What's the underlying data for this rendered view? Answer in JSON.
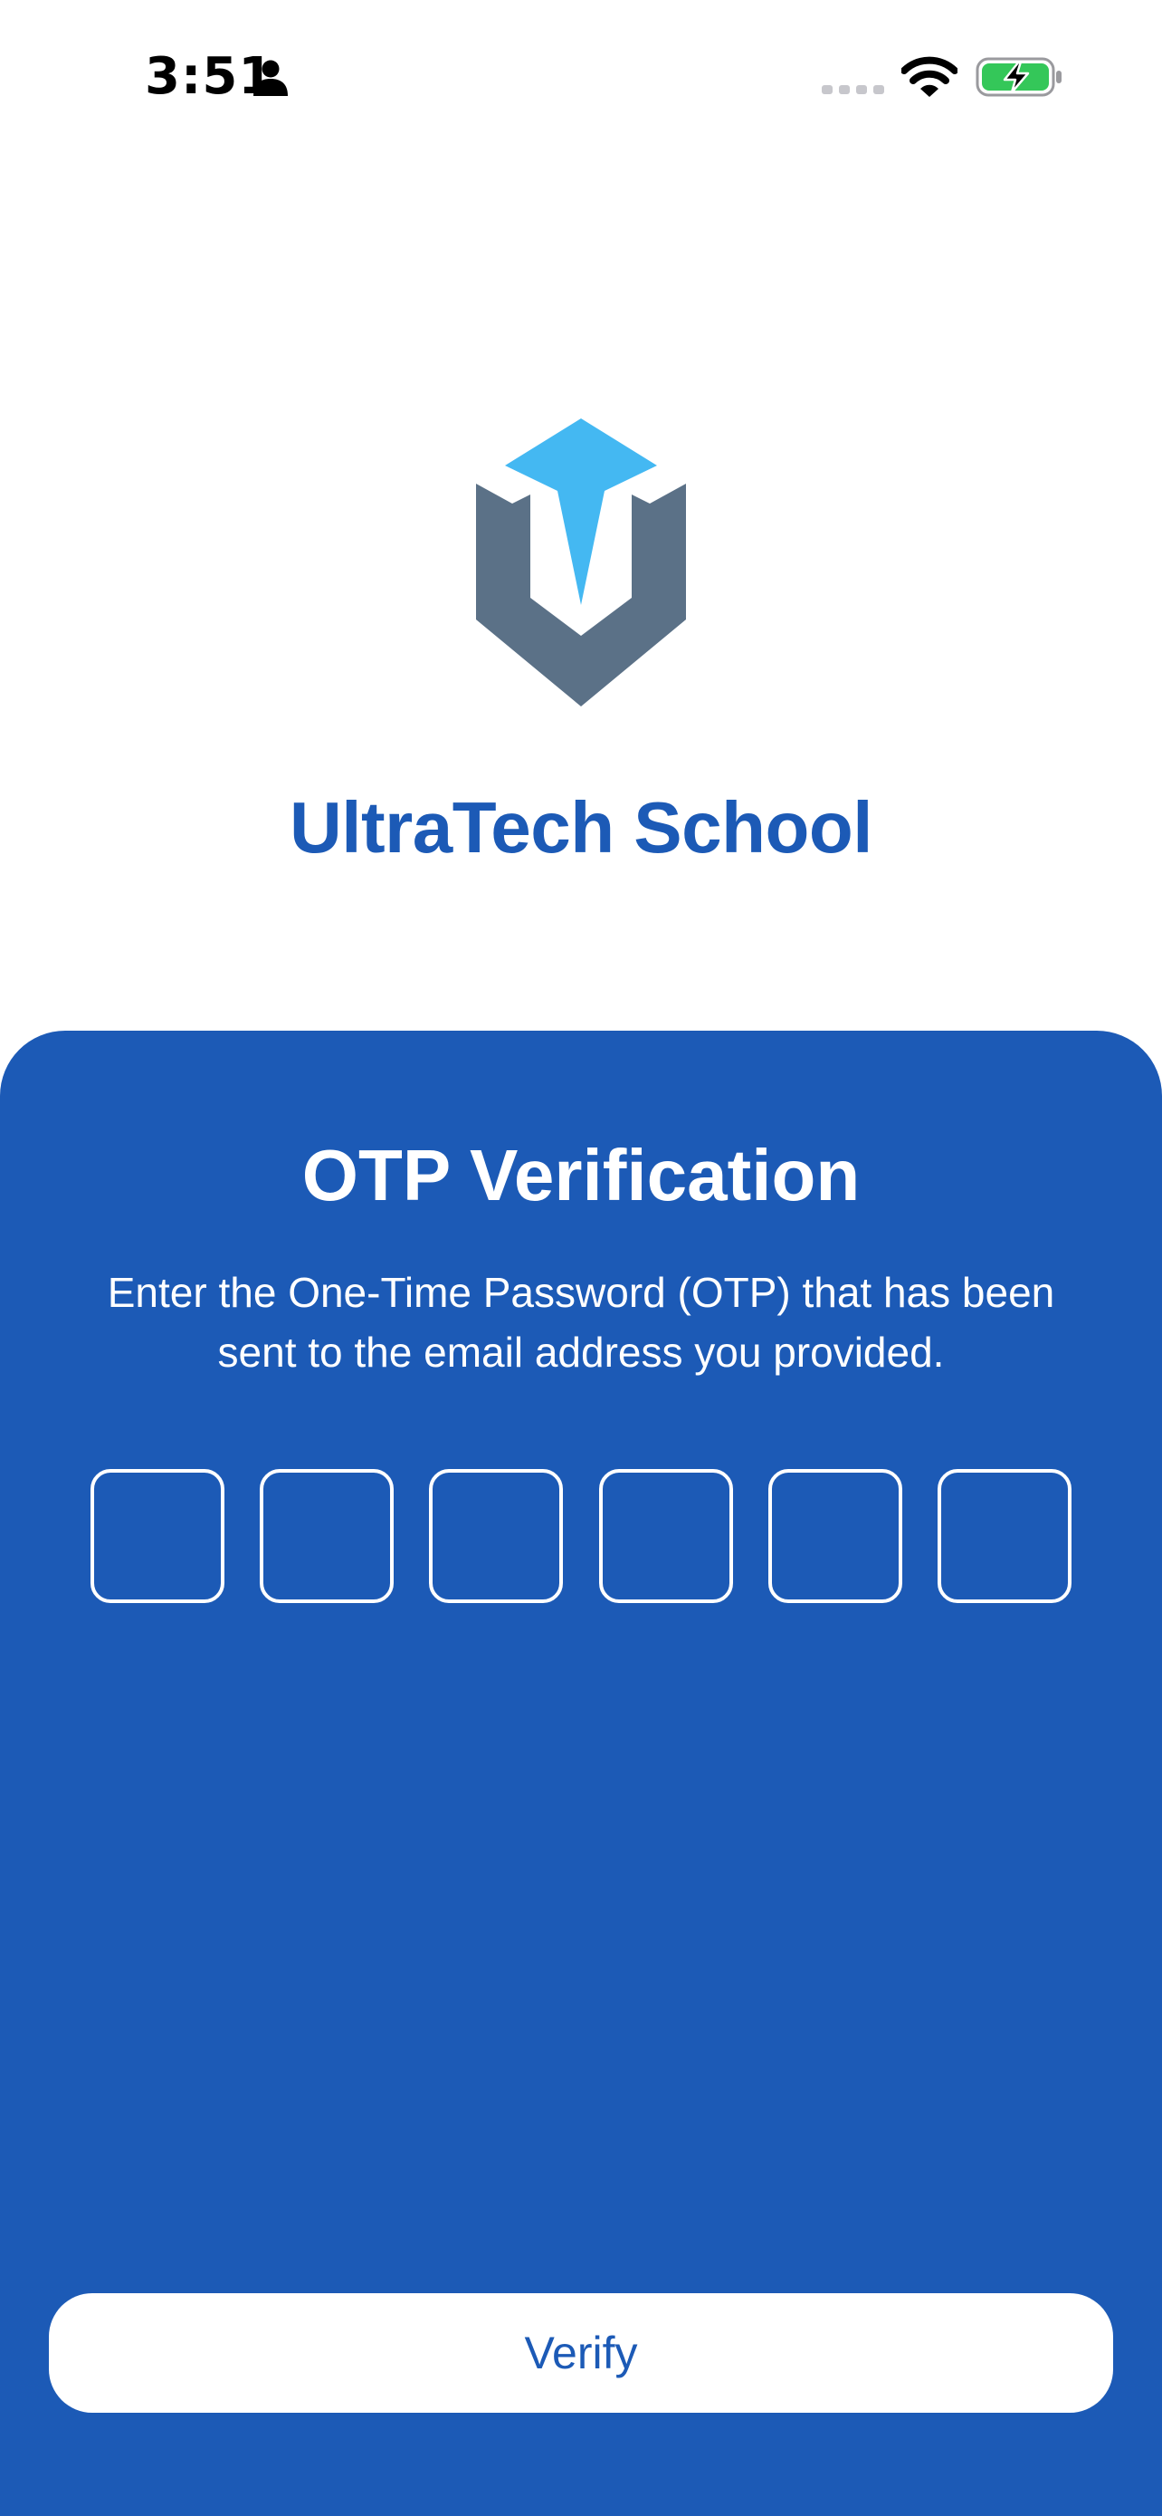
{
  "status_bar": {
    "time": "3:51",
    "icons": [
      "person-icon",
      "cellular-signal-icon",
      "wifi-icon",
      "battery-charging-icon"
    ],
    "battery_color": "#34c759"
  },
  "brand": {
    "name": "UltraTech School",
    "logo": "shield-v-logo",
    "colors": {
      "primary": "#1c5ab6",
      "logo_light": "#44b8f2",
      "logo_dark": "#5b7187"
    }
  },
  "otp": {
    "title": "OTP Verification",
    "description": "Enter the One-Time Password (OTP) that has been sent to the email address you provided.",
    "digits": [
      "",
      "",
      "",
      "",
      "",
      ""
    ]
  },
  "actions": {
    "verify_label": "Verify"
  }
}
